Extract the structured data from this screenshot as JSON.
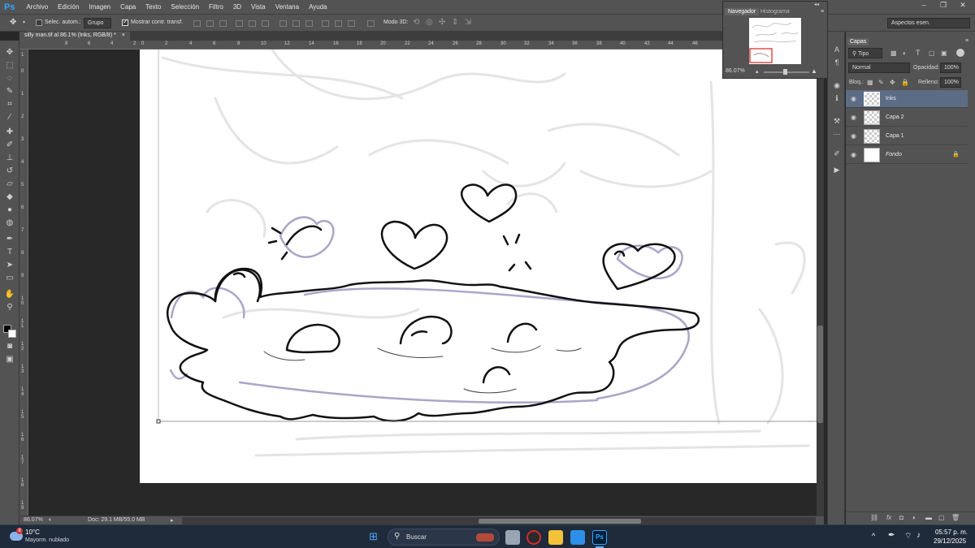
{
  "app": {
    "logo": "Ps",
    "window_controls": [
      "–",
      "❐",
      "✕"
    ]
  },
  "menu": [
    "Archivo",
    "Edición",
    "Imagen",
    "Capa",
    "Texto",
    "Selección",
    "Filtro",
    "3D",
    "Vista",
    "Ventana",
    "Ayuda"
  ],
  "options": {
    "auto_select_label": "Selec. autom.:",
    "auto_select_value": "Grupo",
    "transform_label": "Mostrar contr. transf.",
    "mode3d_label": "Modo 3D:",
    "workspace": "Aspectos esen."
  },
  "document": {
    "tab_title": "silly man.tif al 86.1% (Inks, RGB/8) *",
    "close": "×"
  },
  "ruler_top": [
    "8",
    "6",
    "4",
    "2",
    "0",
    "2",
    "4",
    "6",
    "8",
    "10",
    "12",
    "14",
    "16",
    "18",
    "20",
    "22",
    "24",
    "26",
    "28",
    "30",
    "32",
    "34",
    "36",
    "38",
    "40",
    "42",
    "44",
    "46"
  ],
  "ruler_left": [
    "1",
    "0",
    "1",
    "2",
    "3",
    "4",
    "5",
    "6",
    "7",
    "8",
    "9",
    "1 0",
    "1 1",
    "1 2",
    "1 3",
    "1 4",
    "1 5",
    "1 6",
    "1 7",
    "1 8",
    "1 9"
  ],
  "status": {
    "zoom": "86.07%",
    "doc": "Doc: 29.1 MB/55.0 MB"
  },
  "navigator": {
    "tab_active": "Navegador",
    "tab_other": "Histograma",
    "zoom": "86.07%"
  },
  "layers_panel": {
    "title": "Capas",
    "filter": "Tipo",
    "blend_mode": "Normal",
    "opacity_label": "Opacidad:",
    "opacity": "100%",
    "lock_label": "Bloq.:",
    "fill_label": "Relleno:",
    "fill": "100%",
    "layers": [
      {
        "name": "Inks",
        "selected": true
      },
      {
        "name": "Capa 2",
        "selected": false
      },
      {
        "name": "Capa 1",
        "selected": false
      },
      {
        "name": "Fondo",
        "selected": false
      }
    ],
    "footer_icons": [
      "link-icon",
      "fx-icon",
      "mask-icon",
      "adjustment-icon",
      "group-icon",
      "new-layer-icon",
      "trash-icon"
    ]
  },
  "taskbar": {
    "weather_temp": "10°C",
    "weather_desc": "Mayorm. nublado",
    "weather_badge": "8",
    "search": "Buscar",
    "time": "05:57 p. m.",
    "date": "29/12/2025"
  },
  "colors": {
    "accent": "#31a8ff",
    "selected_layer": "#5c6c85",
    "panel": "#535353",
    "dark": "#282828"
  }
}
